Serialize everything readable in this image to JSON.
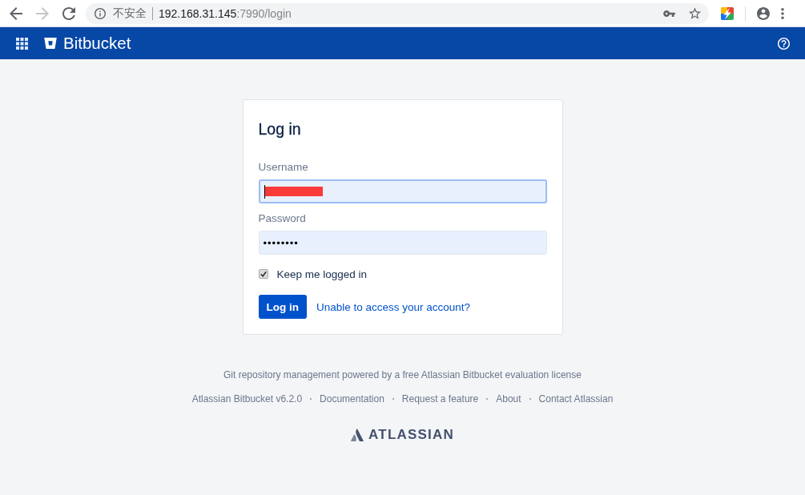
{
  "browser": {
    "back_enabled": true,
    "forward_enabled": false,
    "security_label": "不安全",
    "url_host": "192.168.31.145",
    "url_rest": ":7990/login"
  },
  "header": {
    "product": "Bitbucket"
  },
  "login": {
    "title": "Log in",
    "username": {
      "label": "Username",
      "focused": true,
      "redacted": true
    },
    "password": {
      "label": "Password",
      "value": "••••••••",
      "focused": false
    },
    "remember": {
      "label": "Keep me logged in",
      "checked": true
    },
    "submit": "Log in",
    "help_link": "Unable to access your account?"
  },
  "footer": {
    "license_note": "Git repository management powered by a free Atlassian Bitbucket evaluation license",
    "version": "Atlassian Bitbucket v6.2.0",
    "links": [
      "Documentation",
      "Request a feature",
      "About",
      "Contact Atlassian"
    ],
    "logo_text": "ATLASSIAN"
  }
}
